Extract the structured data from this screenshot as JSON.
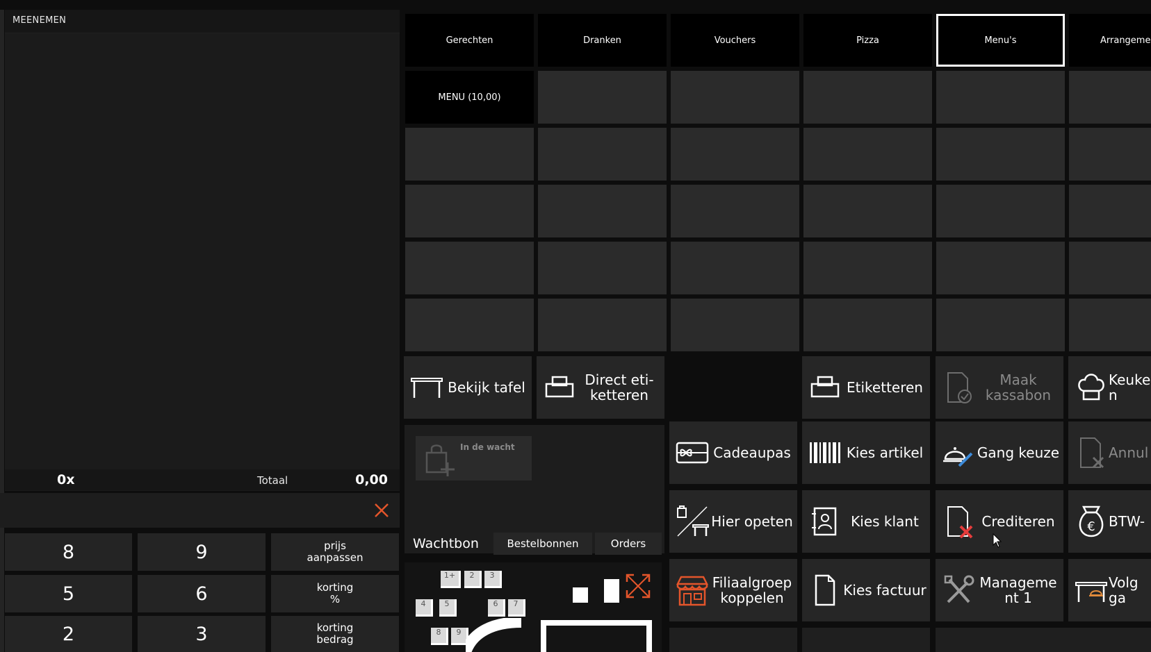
{
  "order": {
    "title": "MEENEMEN",
    "count": "0x",
    "total_label": "Totaal",
    "total_value": "0,00"
  },
  "keypad": [
    {
      "label": "8",
      "kind": "num"
    },
    {
      "label": "9",
      "kind": "num"
    },
    {
      "label": "prijs\naanpassen",
      "kind": "fn"
    },
    {
      "label": "5",
      "kind": "num"
    },
    {
      "label": "6",
      "kind": "num"
    },
    {
      "label": "korting\n%",
      "kind": "fn"
    },
    {
      "label": "2",
      "kind": "num"
    },
    {
      "label": "3",
      "kind": "num"
    },
    {
      "label": "korting\nbedrag",
      "kind": "fn"
    }
  ],
  "categories": [
    {
      "label": "Gerechten",
      "active": false
    },
    {
      "label": "Dranken",
      "active": false
    },
    {
      "label": "Vouchers",
      "active": false
    },
    {
      "label": "Pizza",
      "active": false
    },
    {
      "label": "Menu's",
      "active": true
    },
    {
      "label": "Arrangemen",
      "active": false
    }
  ],
  "products": [
    "MENU (10,00)"
  ],
  "actions": {
    "view_table": "Bekijk tafel",
    "direct_label": "Direct eti-\nketteren",
    "labels": "Etiketteren",
    "make_receipt": "Maak\nkassabon",
    "kitchen": "Keuke\nn",
    "gift_card": "Cadeaupas",
    "choose_article": "Kies artikel",
    "course_choice": "Gang keuze",
    "cancel": "Annul",
    "eat_here": "Hier opeten",
    "choose_customer": "Kies klant",
    "credit": "Crediteren",
    "vat": "BTW-",
    "branch_group": "Filiaalgroep\nkoppelen",
    "choose_invoice": "Kies factuur",
    "management": "Manageme\nnt 1",
    "next_course": "Volg\nga"
  },
  "hold": {
    "label": "In de wacht",
    "tabs": [
      "Wachtbon",
      "Bestelbonnen",
      "Orders"
    ]
  },
  "tables": [
    "1+",
    "2",
    "3",
    "4",
    "5",
    "6",
    "7",
    "8",
    "9"
  ],
  "colors": {
    "accent": "#e4552b",
    "active_border": "#ffffff",
    "disabled_text": "#8a8a8a",
    "empty_tile": "#2b2b2b"
  }
}
